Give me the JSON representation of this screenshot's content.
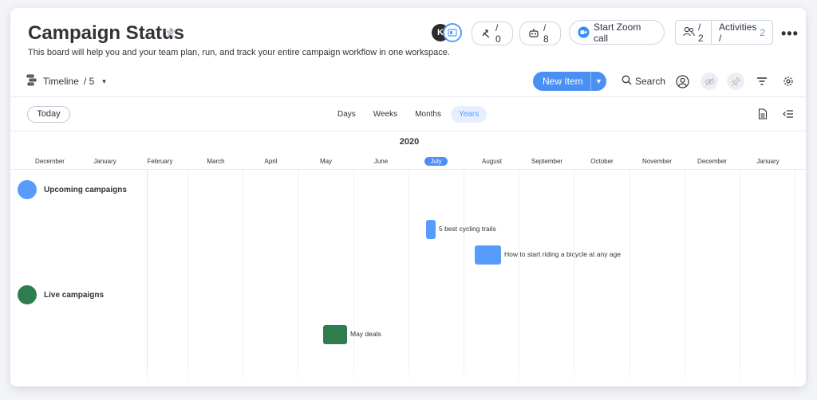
{
  "board": {
    "title": "Campaign Status",
    "description": "This board will help you and your team plan, run, and track your entire campaign workflow in one workspace."
  },
  "header": {
    "avatar_initial": "K",
    "automations_count": "/ 0",
    "integrations_count": "/ 8",
    "zoom_label": "Start Zoom call",
    "members_count": "/ 2",
    "activities_label": "Activities /",
    "activities_count": "2"
  },
  "toolbar": {
    "view_label": "Timeline",
    "view_count": "/ 5",
    "new_item_label": "New Item",
    "search_label": "Search"
  },
  "timeline_controls": {
    "today_label": "Today",
    "scales": [
      "Days",
      "Weeks",
      "Months",
      "Years"
    ],
    "active_scale": "Years"
  },
  "timeline": {
    "year": "2020",
    "months": [
      "December",
      "January",
      "February",
      "March",
      "April",
      "May",
      "June",
      "July",
      "August",
      "September",
      "October",
      "November",
      "December",
      "January"
    ],
    "current_month": "July"
  },
  "groups": [
    {
      "name": "Upcoming campaigns",
      "color": "#579bfc",
      "items": [
        {
          "name": "5 best cycling trails",
          "color": "#579bfc"
        },
        {
          "name": "How to start riding a bicycle at any age",
          "color": "#579bfc"
        }
      ]
    },
    {
      "name": "Live campaigns",
      "color": "#2f7d4f",
      "items": [
        {
          "name": "May deals",
          "color": "#2f7d4f"
        }
      ]
    }
  ]
}
